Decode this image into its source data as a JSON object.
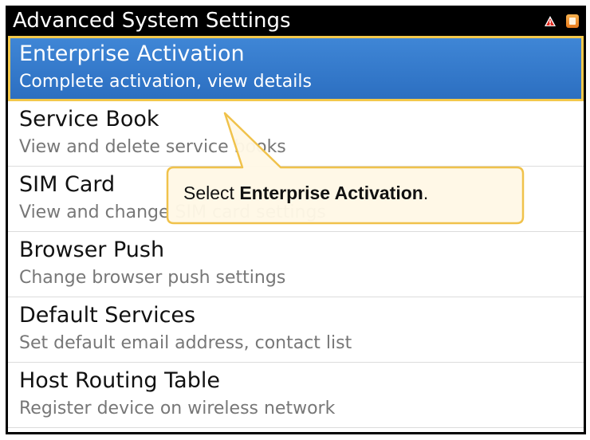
{
  "titlebar": {
    "title": "Advanced System Settings",
    "icons": [
      "warning-icon",
      "notification-icon"
    ]
  },
  "menu": {
    "items": [
      {
        "title": "Enterprise Activation",
        "subtitle": "Complete activation, view details",
        "selected": true
      },
      {
        "title": "Service Book",
        "subtitle": "View and delete service books",
        "selected": false
      },
      {
        "title": "SIM Card",
        "subtitle": "View and change SIM card settings",
        "selected": false
      },
      {
        "title": "Browser Push",
        "subtitle": "Change browser push settings",
        "selected": false
      },
      {
        "title": "Default Services",
        "subtitle": "Set default email address, contact list",
        "selected": false
      },
      {
        "title": "Host Routing Table",
        "subtitle": "Register device on wireless network",
        "selected": false
      }
    ]
  },
  "callout": {
    "prefix": "Select ",
    "emphasis": "Enterprise Activation",
    "suffix": "."
  },
  "colors": {
    "titlebar_bg": "#000000",
    "selection_bg": "#2c6fc1",
    "selection_border": "#f3c84a",
    "callout_bg": "#fff8e6",
    "callout_border": "#f0c24b"
  }
}
